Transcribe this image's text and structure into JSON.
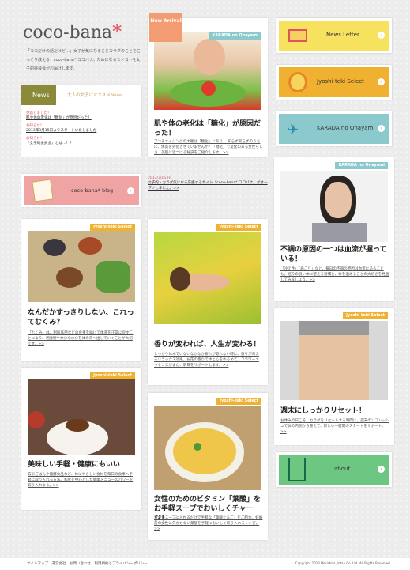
{
  "brand": {
    "logo": "coco-bana",
    "tagline": "「ココだけの話だけど…」女子が気になることカラダのことをこっそり教える　coco-bana* ココバナ。ためになるモノコトを女子的委員会がお届けします。"
  },
  "news": {
    "heading": "News",
    "subheading": "大人の女子にオススメNews",
    "items": [
      {
        "date": "更新しました！",
        "text": "肌や体の老化は「糖化」が原因だった！"
      },
      {
        "date": "お知らせ！",
        "text": "2013年3月15日よりスタートいたしました"
      },
      {
        "date": "お知らせ！",
        "text": "『女子的委員会』とは…！？"
      }
    ]
  },
  "blog": {
    "label": "coco-bana* blog",
    "date": "2013/3/15 FR",
    "text": "女子的・カラダ気になる応援するサイト「coco-bana* ココバナ」がオープンしました。>>"
  },
  "side": {
    "newsletter": "News Letter",
    "jyoshi": "Jyoshi-teki Select",
    "karada": "KARADA no Onayami",
    "about": "about"
  },
  "colors": {
    "accent": "#e0525e",
    "orange": "#f0b030",
    "teal": "#8cc9cc",
    "green": "#6ec683"
  },
  "feature": {
    "badge": "New Arrival",
    "tag": "KARADA no Onayami",
    "title": "肌や体の老化は「糖化」が原因だった！",
    "desc": "アンチエイジングの大敵は「糖化」にあり！ 知らず知らずのうちに、体質を劣化させていませんか？「糖化」で変化のある女性らしさ、美肌に近づける秘訣をご紹介します。>>"
  },
  "tags": {
    "jyoshi": "Jyoshi-teki Select",
    "karada": "KARADA no Onayami"
  },
  "articles": [
    {
      "title": "なんだかすっきりしない、これってむくみ？",
      "desc": "「むくみ」は、利尿作用などの食事を助けて体液を正常に戻すことにより、老廃物や余分な水分を体の外へ出していくことが大切です。>>"
    },
    {
      "title": "美味しい手軽・健康にもいい",
      "desc": "玄米ごはんや発酵食品など、体にやさしい食材を毎日の食事へ手軽に取り入れる方法。和食を中心とした健康メニューのパワーを取り入れよう。>>"
    },
    {
      "title": "香りが変われば、人生が変わる！",
      "desc": "しっかり休んでいないなかなか疲れが取れない時に、香りが与えるリラックス効果。お花の香りで体と心をゆるめて、フラワーエッセンスがまた、明日をサポートします。>>"
    },
    {
      "title": "女性のためのビタミン「葉酸」をお手軽スープでおいしくチャージ！",
      "desc": "温かいスープに入れるだけで手軽な「葉酸たまご」をご紹介。妊娠前の女性に欠かせない葉酸を手軽においしく取り入れるレシピ。>>"
    },
    {
      "title": "不調の原因の一つは血流が握っている！",
      "desc": "「冷え性」「肩こり」など、毎日の不調の原因は血流にあることも。巡りの良い体に整える習慣と、体を温めることの大切さを見直してみましょう。>>"
    },
    {
      "title": "週末にしっかりリセット！",
      "desc": "お休みの日こそ、カラダをリセットする時間に。週末のリフレッシュで体の内側から整えて、新しい一週間のスタートをサポート。>>"
    }
  ],
  "footer": {
    "links": "サイトマップ　運営会社　お問い合わせ　利用規約とプライバシーポリシー",
    "copyright": "Copyright 2013 Morishita Jintan Co.,Ltd. All Rights Reserved."
  }
}
